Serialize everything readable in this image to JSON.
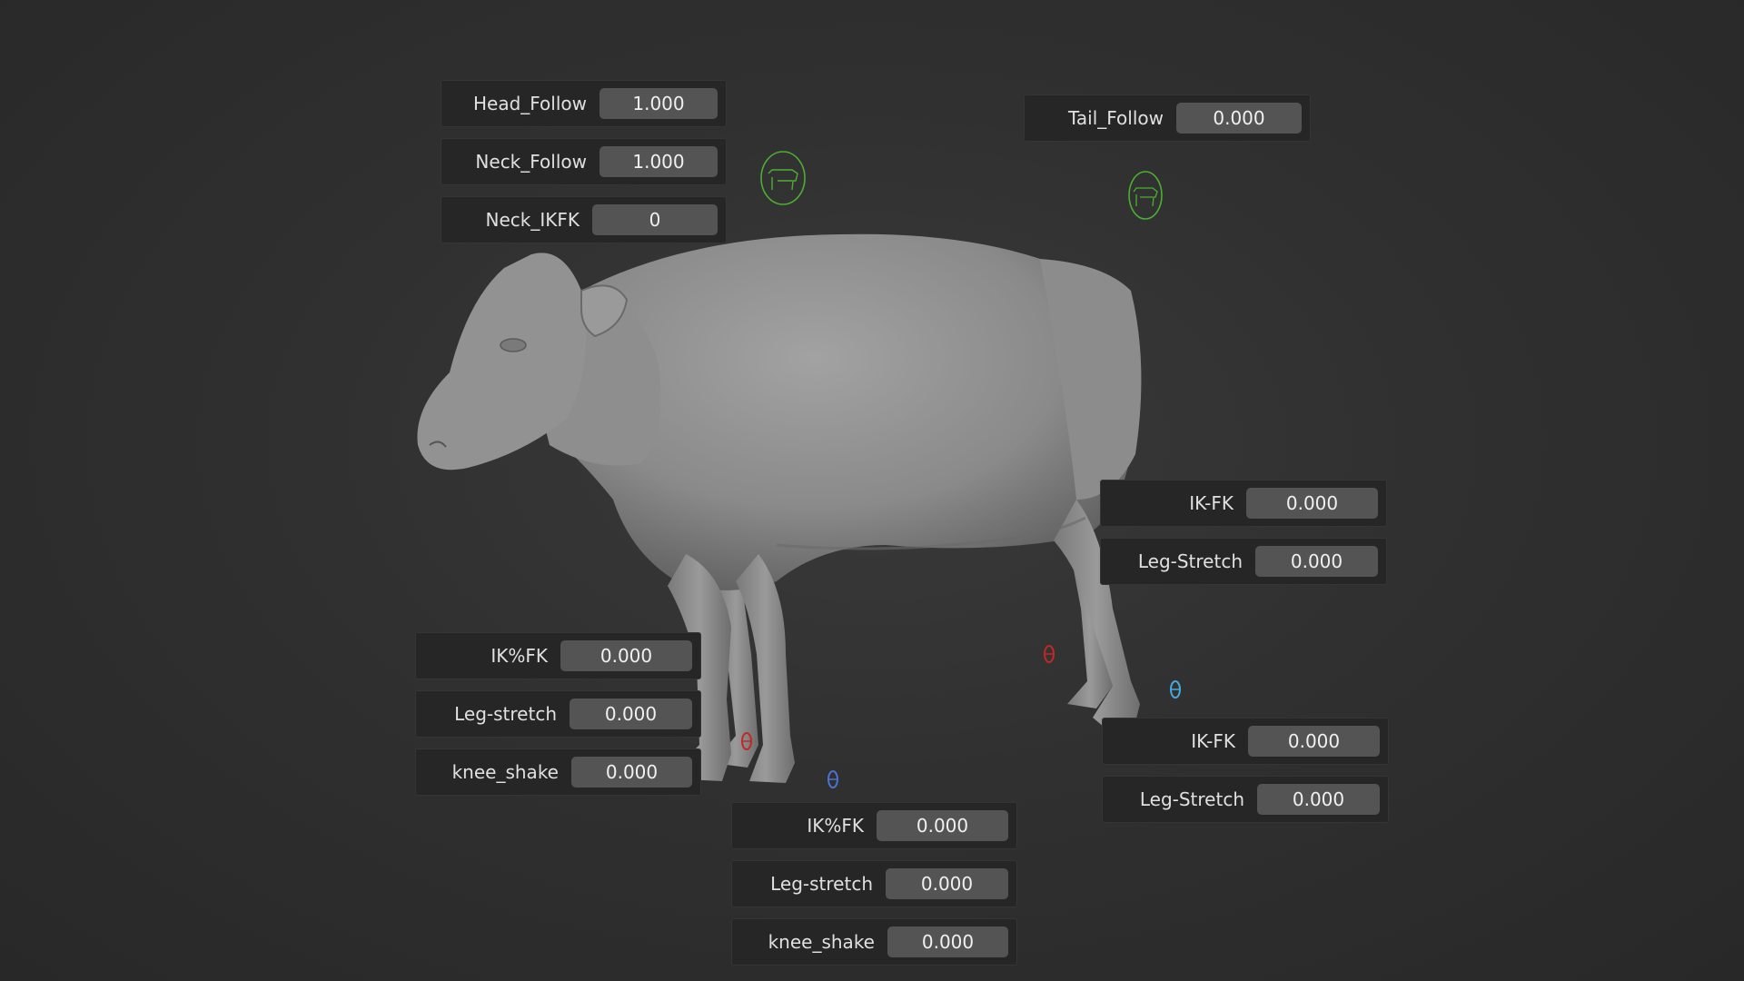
{
  "panels": {
    "head_follow": {
      "label": "Head_Follow",
      "value": "1.000"
    },
    "neck_follow": {
      "label": "Neck_Follow",
      "value": "1.000"
    },
    "neck_ikfk": {
      "label": "Neck_IKFK",
      "value": "0"
    },
    "tail_follow": {
      "label": "Tail_Follow",
      "value": "0.000"
    },
    "back_near_ikfk": {
      "label": "IK-FK",
      "value": "0.000"
    },
    "back_near_stretch": {
      "label": "Leg-Stretch",
      "value": "0.000"
    },
    "back_far_ikfk": {
      "label": "IK-FK",
      "value": "0.000"
    },
    "back_far_stretch": {
      "label": "Leg-Stretch",
      "value": "0.000"
    },
    "front_left_ikfk": {
      "label": "IK%FK",
      "value": "0.000"
    },
    "front_left_stretch": {
      "label": "Leg-stretch",
      "value": "0.000"
    },
    "front_left_knee": {
      "label": "knee_shake",
      "value": "0.000"
    },
    "front_right_ikfk": {
      "label": "IK%FK",
      "value": "0.000"
    },
    "front_right_stretch": {
      "label": "Leg-stretch",
      "value": "0.000"
    },
    "front_right_knee": {
      "label": "knee_shake",
      "value": "0.000"
    }
  },
  "colors": {
    "viewport_bg": "#303030",
    "panel_bg": "#262626",
    "field_bg": "#545454",
    "cow_body": "#8a8a8a",
    "head_control": "#4caf30",
    "foot_control_red": "#c0282a",
    "foot_control_blue": "#4a72d0",
    "foot_control_cyan": "#48a8e0"
  },
  "icons": {
    "head_control": "cow-icon",
    "tail_control": "cow-icon",
    "foot_controls": "foot-ring-icon"
  }
}
